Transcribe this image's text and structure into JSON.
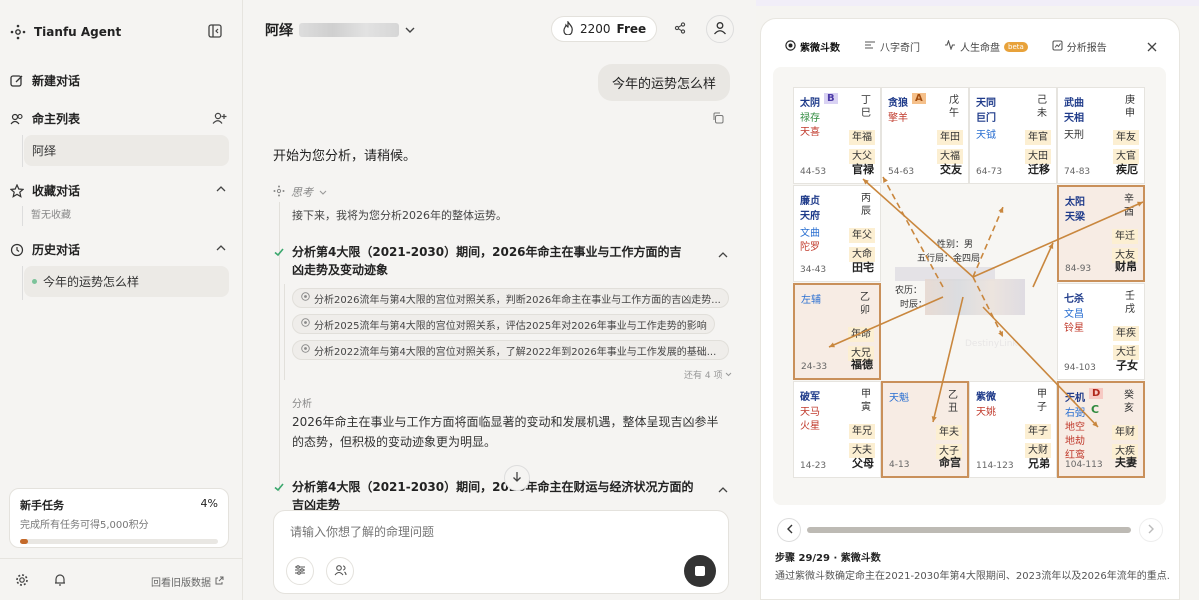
{
  "app": {
    "name": "Tianfu Agent"
  },
  "sidebar": {
    "new_chat": "新建对话",
    "profiles_title": "命主列表",
    "profile_item": "阿绎",
    "favorites_title": "收藏对话",
    "favorites_empty": "暂无收藏",
    "history_title": "历史对话",
    "history_item": "今年的运势怎么样",
    "task": {
      "title": "新手任务",
      "percent_label": "4%",
      "progress": 0.04,
      "desc": "完成所有任务可得5,000积分"
    },
    "old_data_link": "回看旧版数据"
  },
  "header": {
    "profile_name": "阿绎",
    "credits": "2200",
    "plan": "Free"
  },
  "chat": {
    "user_message": "今年的运势怎么样",
    "reply_intro": "开始为您分析，请稍候。",
    "thinking_label": "思考",
    "thinking_text": "接下来，我将为您分析2026年的整体运势。",
    "step1": "分析第4大限（2021-2030）期间，2026年命主在事业与工作方面的吉凶走势及变动迹象",
    "sub_tasks": [
      "分析2026流年与第4大限的宫位对照关系，判断2026年命主在事业与工作方面的吉凶走势...",
      "分析2025流年与第4大限的宫位对照关系，评估2025年对2026年事业与工作走势的影响",
      "分析2022流年与第4大限的宫位对照关系，了解2022年到2026年事业与工作发展的基础..."
    ],
    "more_label": "还有 4 项",
    "analysis_label": "分析",
    "analysis_text": "2026年命主在事业与工作方面将面临显著的变动和发展机遇，整体呈现吉凶参半的态势，但积极的变动迹象更为明显。",
    "step2": "分析第4大限（2021-2030）期间，2026年命主在财运与经济状况方面的吉凶走势",
    "input_placeholder": "请输入你想了解的命理问题"
  },
  "panel": {
    "tabs": [
      "紫微斗数",
      "八字奇门",
      "人生命盘",
      "分析报告"
    ],
    "beta": "beta",
    "step_title": "步骤 29/29 · 紫微斗数",
    "step_desc": "通过紫微斗数确定命主在2021-2030年第4大限期间、2023流年以及2026年流年的重点...",
    "watermark": "DestinyLink",
    "center": {
      "gender": "性别：男",
      "wuxing": "五行局：金四局",
      "lunar": "农历：",
      "shichen": "时辰："
    },
    "cells": [
      {
        "main": "太阴",
        "mark": "B",
        "s1": "禄存",
        "s2": "天喜",
        "gz1": "丁",
        "gz2": "巳",
        "t1": "年福",
        "t2": "大父",
        "palace": "官禄",
        "range": "44-53"
      },
      {
        "main": "贪狼",
        "mark": "A",
        "s1": "擎羊",
        "s2": "",
        "gz1": "戊",
        "gz2": "午",
        "t1": "年田",
        "t2": "大福",
        "palace": "交友",
        "range": "54-63"
      },
      {
        "main": "天同",
        "main2": "巨门",
        "s1": "天钺",
        "s2": "",
        "gz1": "己",
        "gz2": "未",
        "t1": "年官",
        "t2": "大田",
        "palace": "迁移",
        "range": "64-73"
      },
      {
        "main": "武曲",
        "main2": "天相",
        "s1": "天刑",
        "s2": "",
        "gz1": "庚",
        "gz2": "申",
        "t1": "年友",
        "t2": "大官",
        "palace": "疾厄",
        "range": "74-83"
      },
      {
        "main": "廉贞",
        "main2": "天府",
        "s1": "文曲",
        "s2": "陀罗",
        "gz1": "丙",
        "gz2": "辰",
        "t1": "年父",
        "t2": "大命",
        "palace": "田宅",
        "range": "34-43"
      },
      {
        "main": "太阳",
        "main2": "天梁",
        "s1": "",
        "s2": "",
        "gz1": "辛",
        "gz2": "酉",
        "t1": "年迁",
        "t2": "大友",
        "palace": "财帛",
        "range": "84-93"
      },
      {
        "main": "左辅",
        "s1": "",
        "s2": "",
        "gz1": "乙",
        "gz2": "卯",
        "t1": "年命",
        "t2": "大兄",
        "palace": "福德",
        "range": "24-33"
      },
      {
        "main": "七杀",
        "s1": "文昌",
        "s2": "铃星",
        "gz1": "壬",
        "gz2": "戌",
        "t1": "年疾",
        "t2": "大迁",
        "palace": "子女",
        "range": "94-103"
      },
      {
        "main": "破军",
        "s1": "天马",
        "s2": "火星",
        "gz1": "甲",
        "gz2": "寅",
        "t1": "年兄",
        "t2": "大夫",
        "palace": "父母",
        "range": "14-23"
      },
      {
        "main": "天魁",
        "s1": "",
        "s2": "",
        "gz1": "乙",
        "gz2": "丑",
        "t1": "年夫",
        "t2": "大子",
        "palace": "命宫",
        "range": "4-13"
      },
      {
        "main": "紫微",
        "s1": "天姚",
        "s2": "",
        "gz1": "甲",
        "gz2": "子",
        "t1": "年子",
        "t2": "大财",
        "palace": "兄弟",
        "range": "114-123"
      },
      {
        "main": "天机",
        "mark": "D",
        "mark2": "C",
        "s1": "右弼",
        "s2": "地空",
        "s3": "地劫",
        "s4": "红鸾",
        "gz1": "癸",
        "gz2": "亥",
        "t1": "年财",
        "t2": "大疾",
        "palace": "夫妻",
        "range": "104-113"
      }
    ]
  }
}
